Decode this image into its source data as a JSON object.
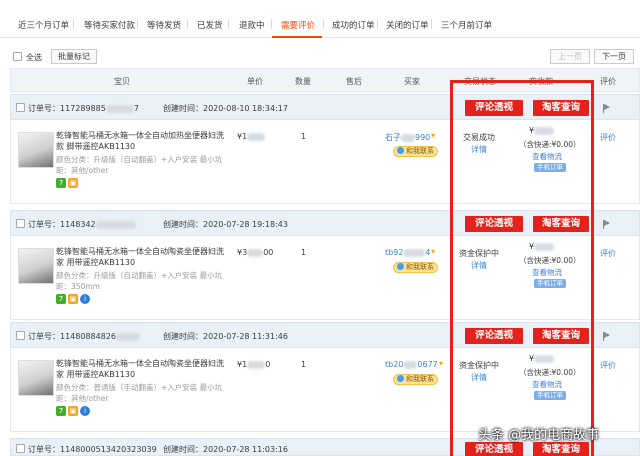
{
  "tabs": [
    {
      "label": "近三个月订单"
    },
    {
      "label": "等待买家付款"
    },
    {
      "label": "等待发货"
    },
    {
      "label": "已发货"
    },
    {
      "label": "退款中"
    },
    {
      "label": "需要评价",
      "active": true
    },
    {
      "label": "成功的订单"
    },
    {
      "label": "关闭的订单"
    },
    {
      "label": "三个月前订单"
    }
  ],
  "toolbar": {
    "select_all_label": "全选",
    "batch_mark_label": "批量标记",
    "prev_label": "上一页",
    "next_label": "下一页"
  },
  "table_headers": {
    "item": "宝贝",
    "price": "单价",
    "qty": "数量",
    "after_sale": "售后",
    "buyer": "买家",
    "status": "交易状态",
    "paid": "实收款",
    "review": "评价"
  },
  "orders": [
    {
      "order_no_label": "订单号：",
      "order_no": "117289885",
      "order_no_tail": "7",
      "created_label": "创建时间：",
      "created": "2020-08-10 18:34:17",
      "product_name": "乾锋智能马桶无水箱一体全自动加热坐便器妇洗款 脚带遥控AKB1130",
      "attr_color": "颜色分类：升级版（自动翻盖）+入户安装 最小坑",
      "attr_extra": "距：其他/other",
      "price_prefix": "¥1",
      "qty": "1",
      "buyer": "石子",
      "buyer_tail": "990",
      "wangwang": "和我联系",
      "status": "交易成功",
      "detail": "详情",
      "paid_prefix": "¥",
      "shipping": "（含快递:¥0.00）",
      "logistics": "查看物流",
      "mobile_order": "手机订单",
      "review": "评价",
      "btn_insight": "评论透视",
      "btn_taoke": "淘客查询"
    },
    {
      "order_no_label": "订单号：",
      "order_no": "1148342",
      "order_no_tail": "",
      "created_label": "创建时间：",
      "created": "2020-07-28 19:18:43",
      "product_name": "乾锋智能马桶无水箱一体全自动陶瓷坐便器妇洗家 用带遥控AKB1130",
      "attr_color": "颜色分类：升级版（自动翻盖）+入户安装 最小坑",
      "attr_extra": "距：350mm",
      "price_prefix": "¥3",
      "price_tail": "00",
      "qty": "1",
      "buyer": "tb92",
      "buyer_tail": "4",
      "wangwang": "和我联系",
      "status": "资金保护中",
      "detail": "详情",
      "paid_prefix": "¥",
      "shipping": "（含快递:¥0.00）",
      "logistics": "查看物流",
      "mobile_order": "手机订单",
      "review": "评价",
      "btn_insight": "评论透视",
      "btn_taoke": "淘客查询"
    },
    {
      "order_no_label": "订单号：",
      "order_no": "11480884826",
      "order_no_tail": "",
      "created_label": "创建时间：",
      "created": "2020-07-28 11:31:46",
      "product_name": "乾锋智能马桶无水箱一体全自动陶瓷坐便器妇洗家 用带遥控AKB1130",
      "attr_color": "颜色分类：普通版（手动翻盖）+入户安装 最小坑",
      "attr_extra": "距：其他/other",
      "price_prefix": "¥1",
      "price_tail": "0",
      "qty": "1",
      "buyer": "tb20",
      "buyer_tail": "0677",
      "wangwang": "和我联系",
      "status": "资金保护中",
      "detail": "详情",
      "paid_prefix": "¥",
      "shipping": "（含快递:¥0.00）",
      "logistics": "查看物流",
      "mobile_order": "手机订单",
      "review": "评价",
      "btn_insight": "评论透视",
      "btn_taoke": "淘客查询"
    },
    {
      "order_no_label": "订单号：",
      "order_no": "1148000513420323039",
      "created_label": "创建时间：",
      "created": "2020-07-28 11:03:16",
      "btn_insight": "评论透视",
      "btn_taoke": "淘客查询"
    }
  ],
  "watermark": "头条 @我的电商故事",
  "colors": {
    "accent": "#ff4400",
    "highlight": "#e3231b",
    "link": "#3c82d6"
  }
}
